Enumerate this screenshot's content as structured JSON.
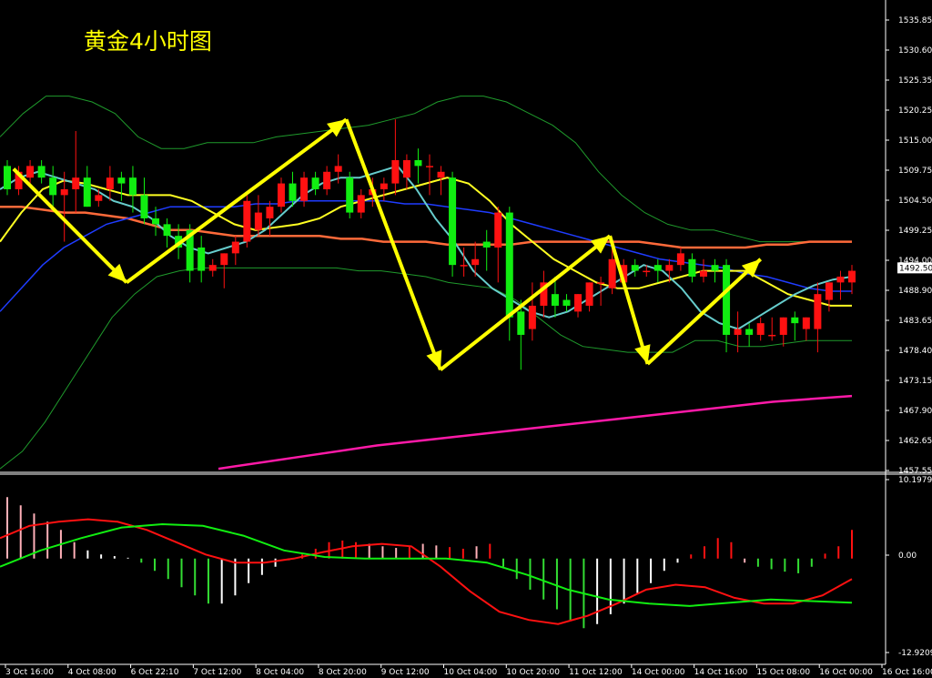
{
  "title": "黄金4小时图",
  "colors": {
    "background": "#000000",
    "axis": "#ffffff",
    "candle_up": "#ff1111",
    "candle_down": "#11ee11",
    "bollinger": "#1f9a2c",
    "ma_orange": "#ff6a3a",
    "ma_blue": "#1f3cff",
    "ma_yellow": "#ffff22",
    "ma_cyan": "#66cccc",
    "ma_magenta": "#ff1aa8",
    "arrow": "#ffff00",
    "macd_red": "#ff1111",
    "macd_green": "#11ee11",
    "hist_pink": "#ffb0b8",
    "hist_white": "#ffffff",
    "hist_red": "#ff1111",
    "hist_green": "#33dd33",
    "current_price_box": "#ffffff"
  },
  "current_price": "1492.50",
  "macd_labels": {
    "top": "10.1979",
    "zero": "0.00",
    "bottom": "-12.9209"
  },
  "chart_data": [
    {
      "type": "candlestick",
      "title": "黄金4小时图",
      "ylim": [
        1457.55,
        1538.5
      ],
      "y_ticks": [
        "1535.85",
        "1530.60",
        "1525.35",
        "1520.25",
        "1515.00",
        "1509.75",
        "1504.50",
        "1499.25",
        "1494.00",
        "1488.90",
        "1483.65",
        "1478.40",
        "1473.15",
        "1467.90",
        "1462.65",
        "1457.55"
      ],
      "x_labels": [
        "3 Oct 16:00",
        "4 Oct 08:00",
        "6 Oct 22:10",
        "7 Oct 12:00",
        "8 Oct 04:00",
        "8 Oct 20:00",
        "9 Oct 12:00",
        "10 Oct 04:00",
        "10 Oct 20:00",
        "11 Oct 12:00",
        "14 Oct 00:00",
        "14 Oct 16:00",
        "15 Oct 08:00",
        "16 Oct 00:00",
        "16 Oct 16:00"
      ],
      "candles": [
        {
          "o": 1510,
          "h": 1511,
          "l": 1505,
          "c": 1506
        },
        {
          "o": 1506,
          "h": 1510,
          "l": 1505,
          "c": 1509
        },
        {
          "o": 1508,
          "h": 1511,
          "l": 1507,
          "c": 1510
        },
        {
          "o": 1510,
          "h": 1511,
          "l": 1507,
          "c": 1508
        },
        {
          "o": 1508,
          "h": 1510,
          "l": 1503,
          "c": 1505
        },
        {
          "o": 1505,
          "h": 1509,
          "l": 1497,
          "c": 1506
        },
        {
          "o": 1506,
          "h": 1516,
          "l": 1502,
          "c": 1508
        },
        {
          "o": 1508,
          "h": 1510,
          "l": 1503,
          "c": 1503
        },
        {
          "o": 1504,
          "h": 1506,
          "l": 1503,
          "c": 1505
        },
        {
          "o": 1506,
          "h": 1510,
          "l": 1504,
          "c": 1508
        },
        {
          "o": 1508,
          "h": 1509,
          "l": 1504,
          "c": 1507
        },
        {
          "o": 1508,
          "h": 1510,
          "l": 1502,
          "c": 1505
        },
        {
          "o": 1505,
          "h": 1508,
          "l": 1500,
          "c": 1501
        },
        {
          "o": 1501,
          "h": 1503,
          "l": 1498,
          "c": 1500
        },
        {
          "o": 1500,
          "h": 1501,
          "l": 1496,
          "c": 1498
        },
        {
          "o": 1498,
          "h": 1500,
          "l": 1494,
          "c": 1496
        },
        {
          "o": 1499,
          "h": 1500,
          "l": 1490,
          "c": 1492
        },
        {
          "o": 1496,
          "h": 1498,
          "l": 1490,
          "c": 1492
        },
        {
          "o": 1492,
          "h": 1494,
          "l": 1491,
          "c": 1493
        },
        {
          "o": 1493,
          "h": 1495,
          "l": 1489,
          "c": 1495
        },
        {
          "o": 1495,
          "h": 1498,
          "l": 1493,
          "c": 1497
        },
        {
          "o": 1497,
          "h": 1505,
          "l": 1496,
          "c": 1504
        },
        {
          "o": 1499,
          "h": 1505,
          "l": 1498,
          "c": 1502
        },
        {
          "o": 1501,
          "h": 1504,
          "l": 1498,
          "c": 1503
        },
        {
          "o": 1503,
          "h": 1508,
          "l": 1502,
          "c": 1507
        },
        {
          "o": 1507,
          "h": 1509,
          "l": 1503,
          "c": 1504
        },
        {
          "o": 1504,
          "h": 1509,
          "l": 1503,
          "c": 1508
        },
        {
          "o": 1508,
          "h": 1509,
          "l": 1505,
          "c": 1506
        },
        {
          "o": 1506,
          "h": 1510,
          "l": 1505,
          "c": 1509
        },
        {
          "o": 1509,
          "h": 1512,
          "l": 1507,
          "c": 1510
        },
        {
          "o": 1508,
          "h": 1509,
          "l": 1501,
          "c": 1502
        },
        {
          "o": 1502,
          "h": 1506,
          "l": 1501,
          "c": 1505
        },
        {
          "o": 1505,
          "h": 1508,
          "l": 1503,
          "c": 1506
        },
        {
          "o": 1506,
          "h": 1508,
          "l": 1504,
          "c": 1507
        },
        {
          "o": 1507,
          "h": 1518,
          "l": 1505,
          "c": 1511
        },
        {
          "o": 1508,
          "h": 1512,
          "l": 1506,
          "c": 1511
        },
        {
          "o": 1511,
          "h": 1513,
          "l": 1507,
          "c": 1510
        },
        {
          "o": 1510,
          "h": 1512,
          "l": 1505,
          "c": 1510
        },
        {
          "o": 1508,
          "h": 1510,
          "l": 1505,
          "c": 1509
        },
        {
          "o": 1508,
          "h": 1509,
          "l": 1491,
          "c": 1493
        },
        {
          "o": 1493,
          "h": 1496,
          "l": 1491,
          "c": 1493
        },
        {
          "o": 1493,
          "h": 1497,
          "l": 1491,
          "c": 1494
        },
        {
          "o": 1497,
          "h": 1499,
          "l": 1492,
          "c": 1496
        },
        {
          "o": 1496,
          "h": 1503,
          "l": 1490,
          "c": 1502
        },
        {
          "o": 1502,
          "h": 1503,
          "l": 1480,
          "c": 1484
        },
        {
          "o": 1485,
          "h": 1487,
          "l": 1475,
          "c": 1481
        },
        {
          "o": 1482,
          "h": 1490,
          "l": 1480,
          "c": 1486
        },
        {
          "o": 1486,
          "h": 1492,
          "l": 1484,
          "c": 1490
        },
        {
          "o": 1488,
          "h": 1491,
          "l": 1484,
          "c": 1486
        },
        {
          "o": 1487,
          "h": 1488,
          "l": 1485,
          "c": 1486
        },
        {
          "o": 1485,
          "h": 1488,
          "l": 1484,
          "c": 1488
        },
        {
          "o": 1486,
          "h": 1490,
          "l": 1485,
          "c": 1490
        },
        {
          "o": 1490,
          "h": 1491,
          "l": 1486,
          "c": 1490
        },
        {
          "o": 1489,
          "h": 1496,
          "l": 1488,
          "c": 1494
        },
        {
          "o": 1490,
          "h": 1494,
          "l": 1489,
          "c": 1493
        },
        {
          "o": 1493,
          "h": 1494,
          "l": 1491,
          "c": 1492
        },
        {
          "o": 1492,
          "h": 1493,
          "l": 1491,
          "c": 1492
        },
        {
          "o": 1493,
          "h": 1494,
          "l": 1490,
          "c": 1492
        },
        {
          "o": 1492,
          "h": 1494,
          "l": 1490,
          "c": 1493
        },
        {
          "o": 1493,
          "h": 1496,
          "l": 1492,
          "c": 1495
        },
        {
          "o": 1494,
          "h": 1495,
          "l": 1490,
          "c": 1491
        },
        {
          "o": 1491,
          "h": 1494,
          "l": 1490,
          "c": 1492
        },
        {
          "o": 1493,
          "h": 1494,
          "l": 1490,
          "c": 1492
        },
        {
          "o": 1493,
          "h": 1494,
          "l": 1478,
          "c": 1481
        },
        {
          "o": 1481,
          "h": 1485,
          "l": 1478,
          "c": 1482
        },
        {
          "o": 1482,
          "h": 1483,
          "l": 1479,
          "c": 1481
        },
        {
          "o": 1481,
          "h": 1484,
          "l": 1480,
          "c": 1483
        },
        {
          "o": 1481,
          "h": 1484,
          "l": 1480,
          "c": 1481
        },
        {
          "o": 1481,
          "h": 1484,
          "l": 1479,
          "c": 1484
        },
        {
          "o": 1484,
          "h": 1485,
          "l": 1480,
          "c": 1483
        },
        {
          "o": 1482,
          "h": 1484,
          "l": 1480,
          "c": 1484
        },
        {
          "o": 1482,
          "h": 1490,
          "l": 1478,
          "c": 1488
        },
        {
          "o": 1487,
          "h": 1490,
          "l": 1485,
          "c": 1490
        },
        {
          "o": 1490,
          "h": 1492,
          "l": 1487,
          "c": 1491
        },
        {
          "o": 1490,
          "h": 1493,
          "l": 1488,
          "c": 1492
        }
      ],
      "series": [
        {
          "id": "ma_orange",
          "values": [
            1503,
            1503,
            1502.5,
            1502,
            1502,
            1501.5,
            1501,
            1500,
            1499,
            1499,
            1498.5,
            1498,
            1498,
            1498,
            1498,
            1498,
            1497.5,
            1497.5,
            1497,
            1497,
            1497,
            1496.5,
            1496.5,
            1496.5,
            1496.5,
            1497,
            1497,
            1497,
            1497,
            1497,
            1497,
            1496.5,
            1496,
            1496,
            1496,
            1496,
            1496.5,
            1496.5,
            1497,
            1497,
            1497
          ]
        },
        {
          "id": "ma_blue",
          "values": [
            1485,
            1489,
            1493,
            1496,
            1498,
            1500,
            1501,
            1502,
            1503,
            1503,
            1503,
            1503,
            1503.5,
            1503.5,
            1504,
            1504,
            1504,
            1504,
            1504,
            1503.5,
            1503.5,
            1503,
            1502.5,
            1502,
            1501,
            1500,
            1499,
            1498,
            1497,
            1496,
            1495,
            1494,
            1493.5,
            1493,
            1492.5,
            1491.5,
            1491,
            1490,
            1489,
            1488.5,
            1488.5
          ]
        },
        {
          "id": "ma_yellow",
          "values": [
            1497,
            1502,
            1506,
            1507.5,
            1507,
            1506,
            1505,
            1505,
            1505,
            1504,
            1502,
            1500,
            1499,
            1499.5,
            1500,
            1501,
            1503,
            1504,
            1505,
            1506,
            1507,
            1508,
            1507,
            1504,
            1500,
            1497,
            1494,
            1492,
            1490,
            1489,
            1489,
            1490,
            1491,
            1492,
            1492,
            1492,
            1490,
            1488,
            1487,
            1486,
            1486
          ]
        },
        {
          "id": "ma_cyan",
          "values": [
            1506,
            1508,
            1509,
            1508,
            1507,
            1506,
            1504,
            1503,
            1501,
            1498,
            1496,
            1495,
            1496,
            1497,
            1499,
            1502,
            1505,
            1507,
            1508,
            1508,
            1509,
            1510,
            1506,
            1501,
            1497,
            1492,
            1489,
            1487,
            1485,
            1484,
            1485,
            1487,
            1489,
            1491,
            1493,
            1492,
            1489,
            1485,
            1483,
            1482,
            1484,
            1486,
            1488,
            1489.5,
            1490.5,
            1491
          ]
        },
        {
          "id": "bb_upper",
          "values": [
            1515,
            1519,
            1522,
            1522,
            1521,
            1519,
            1515,
            1513,
            1513,
            1514,
            1514,
            1514,
            1515,
            1515.5,
            1516,
            1516.5,
            1517,
            1518,
            1519,
            1521,
            1522,
            1522,
            1521,
            1519,
            1517,
            1514,
            1509,
            1505,
            1502,
            1500,
            1499,
            1499,
            1498,
            1497,
            1497,
            1497,
            1497,
            1497
          ]
        },
        {
          "id": "bb_lower",
          "values": [
            1458,
            1461,
            1466,
            1472,
            1478,
            1484,
            1488,
            1491,
            1492,
            1492.5,
            1492.5,
            1492.5,
            1492.5,
            1492.5,
            1492.5,
            1492.5,
            1492,
            1492,
            1491.5,
            1491,
            1490,
            1489.5,
            1489,
            1487,
            1484,
            1481,
            1479,
            1478.5,
            1478,
            1478,
            1478,
            1480,
            1480,
            1479,
            1479,
            1479.5,
            1480,
            1480,
            1480
          ]
        },
        {
          "id": "ma_magenta",
          "values": [
            1458,
            1460,
            1462,
            1463.5,
            1465,
            1466.5,
            1468,
            1469.5,
            1470.5
          ]
        }
      ],
      "arrows": [
        {
          "from": [
            1,
            1509.5
          ],
          "to": [
            19,
            1490
          ]
        },
        {
          "from": [
            19,
            1490
          ],
          "to": [
            54,
            1518
          ]
        },
        {
          "from": [
            54,
            1518
          ],
          "to": [
            69,
            1475
          ]
        },
        {
          "from": [
            69,
            1475
          ],
          "to": [
            96,
            1498
          ]
        },
        {
          "from": [
            96,
            1498
          ],
          "to": [
            102,
            1476
          ]
        },
        {
          "from": [
            102,
            1476
          ],
          "to": [
            120,
            1494
          ]
        }
      ]
    },
    {
      "type": "macd",
      "ylim": [
        -12.9209,
        10.1979
      ],
      "histogram": [
        7.5,
        6.5,
        5.5,
        4.5,
        3.5,
        2,
        1,
        0.5,
        0.3,
        0.1,
        -0.5,
        -1.5,
        -2.5,
        -3.5,
        -4.5,
        -5.5,
        -5.5,
        -4.5,
        -3,
        -2,
        -1,
        -0.2,
        0.5,
        1.2,
        2,
        2.2,
        2,
        1.8,
        1.5,
        1.3,
        1.5,
        1.8,
        1.6,
        1.4,
        1.2,
        1.5,
        1.8,
        -1,
        -2.5,
        -3.8,
        -5,
        -6.2,
        -7.5,
        -8.5,
        -8,
        -6.8,
        -5.5,
        -4.2,
        -3,
        -1.5,
        -0.5,
        0.5,
        1.5,
        2.5,
        2,
        -0.5,
        -1,
        -1.3,
        -1.6,
        -1.8,
        -1,
        0.6,
        1.5,
        3.5
      ],
      "hist_colors": [
        "pink",
        "pink",
        "pink",
        "pink",
        "pink",
        "pink",
        "white",
        "white",
        "white",
        "white",
        "green",
        "green",
        "green",
        "green",
        "green",
        "green",
        "white",
        "white",
        "white",
        "white",
        "white",
        "white",
        "red",
        "red",
        "red",
        "red",
        "red",
        "pink",
        "pink",
        "pink",
        "red",
        "pink",
        "pink",
        "red",
        "red",
        "pink",
        "red",
        "green",
        "green",
        "green",
        "green",
        "green",
        "green",
        "green",
        "white",
        "white",
        "white",
        "white",
        "white",
        "white",
        "white",
        "red",
        "red",
        "red",
        "red",
        "pink",
        "green",
        "green",
        "green",
        "green",
        "green",
        "red",
        "red",
        "red"
      ],
      "macd_red": [
        2.5,
        4,
        4.5,
        4.8,
        4.5,
        3.5,
        2,
        0.5,
        -0.5,
        -0.5,
        0,
        0.8,
        1.5,
        1.8,
        1.5,
        -1,
        -4,
        -6.5,
        -7.5,
        -8,
        -7,
        -5.5,
        -3.8,
        -3.2,
        -3.5,
        -4.8,
        -5.5,
        -5.5,
        -4.5,
        -2.5
      ],
      "macd_green": [
        -1,
        1,
        2.5,
        3.8,
        4.2,
        4,
        2.8,
        1,
        0.2,
        0,
        0,
        0,
        -0.5,
        -2,
        -3.8,
        -5,
        -5.5,
        -5.8,
        -5.4,
        -5,
        -5.2,
        -5.4
      ]
    }
  ]
}
